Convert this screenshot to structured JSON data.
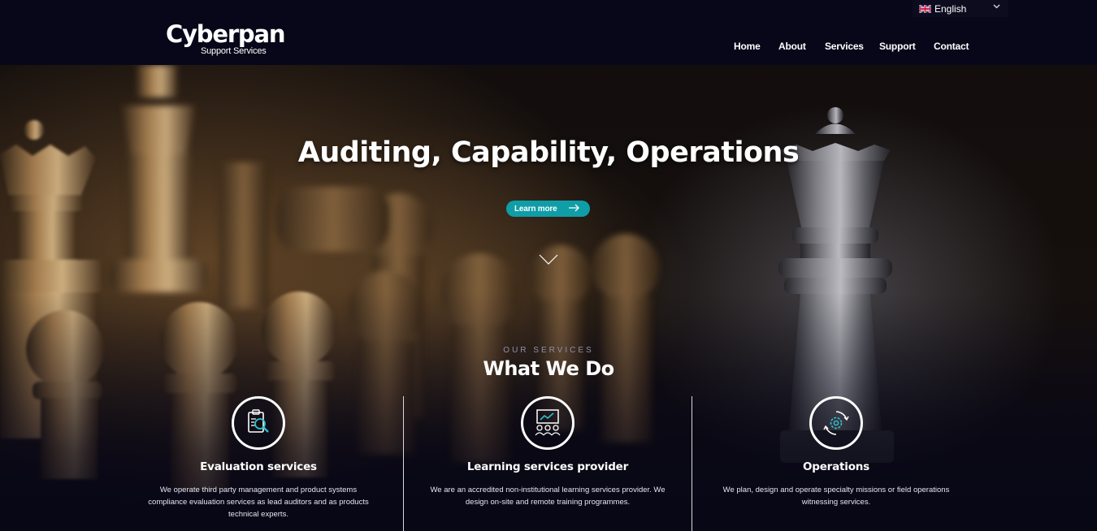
{
  "header": {
    "language": {
      "label": "English",
      "flag_icon": "uk-flag-icon"
    },
    "logo": {
      "main": "Cyberpan",
      "sub": "Support Services"
    },
    "nav": [
      {
        "label": "Home"
      },
      {
        "label": "About"
      },
      {
        "label": "Services"
      },
      {
        "label": "Support"
      },
      {
        "label": "Contact"
      }
    ]
  },
  "hero": {
    "headline": "Auditing, Capability, Operations",
    "cta_label": "Learn more",
    "scroll_icon": "chevron-down-icon"
  },
  "services": {
    "eyebrow": "OUR SERVICES",
    "title": "What We Do",
    "items": [
      {
        "icon": "audit-magnifier-icon",
        "name": "Evaluation services",
        "description": "We operate third party management and product systems compliance evaluation services as lead auditors and as products technical experts."
      },
      {
        "icon": "training-presentation-icon",
        "name": "Learning services provider",
        "description": "We are an accredited non-institutional learning services provider. We design on-site and remote training programmes."
      },
      {
        "icon": "operations-gear-icon",
        "name": "Operations",
        "description": "We plan, design and operate specialty missions or field operations witnessing services."
      }
    ]
  },
  "colors": {
    "accent": "#0f9ea7",
    "background": "#08071a",
    "text": "#ffffff"
  }
}
